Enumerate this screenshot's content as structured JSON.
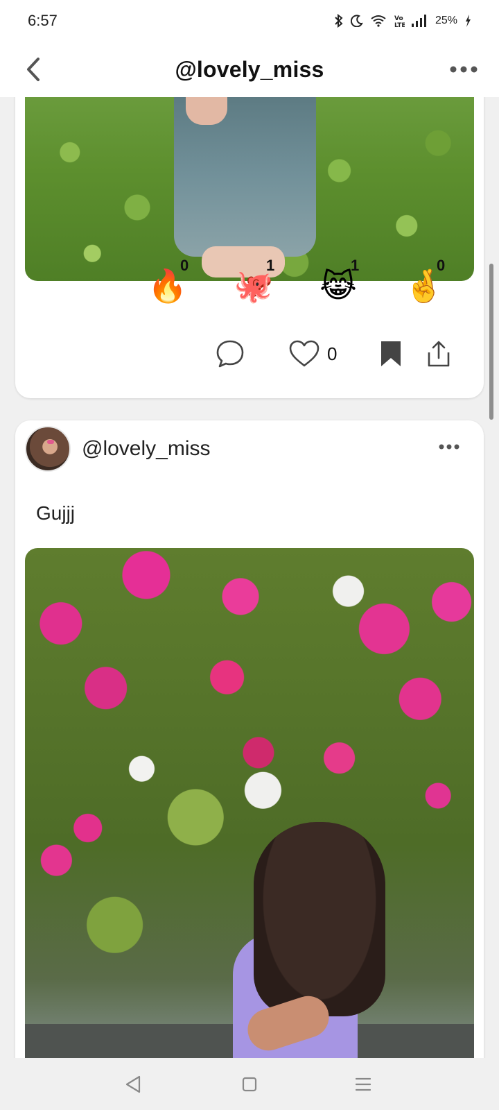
{
  "status_bar": {
    "time": "6:57",
    "battery_percent": "25%",
    "icons": [
      "bluetooth-icon",
      "moon-icon",
      "wifi-icon",
      "volte-icon",
      "signal-icon",
      "battery-charging-icon"
    ]
  },
  "header": {
    "title": "@lovely_miss",
    "back_icon": "chevron-left-icon",
    "more_icon": "more-horizontal-icon"
  },
  "post_1": {
    "reactions": [
      {
        "emoji": "🔥",
        "name": "fire",
        "count": "0"
      },
      {
        "emoji": "🐙",
        "name": "octopus",
        "count": "1"
      },
      {
        "emoji": "😹",
        "name": "cat-tears-of-joy",
        "count": "1"
      },
      {
        "emoji": "🤞",
        "name": "crossed-fingers",
        "count": "0"
      }
    ],
    "actions": {
      "like_count": "0"
    }
  },
  "post_2": {
    "username": "@lovely_miss",
    "caption": "Gujjj"
  },
  "colors": {
    "background": "#f0f0f0",
    "card": "#ffffff",
    "text": "#111111",
    "icon": "#333333"
  },
  "nav_bar": {
    "buttons": [
      "back-triangle-icon",
      "home-square-icon",
      "menu-lines-icon"
    ]
  }
}
